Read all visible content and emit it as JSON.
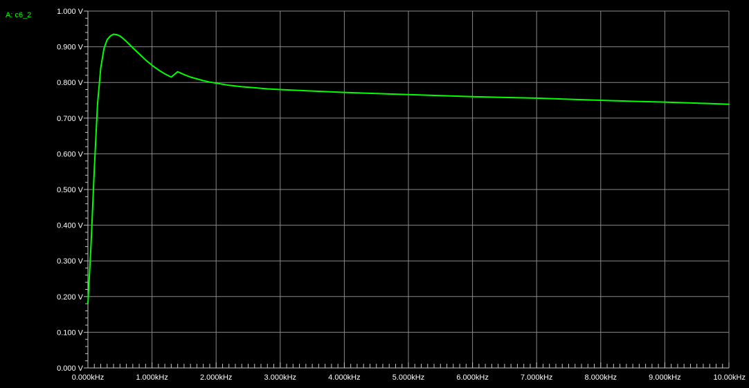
{
  "trace": {
    "label": "A: c6_2",
    "color": "#00ff00"
  },
  "chart_data": {
    "type": "line",
    "xlim": [
      0,
      10
    ],
    "ylim": [
      0,
      1
    ],
    "grid": true,
    "y_tick_labels": [
      "0.000 V",
      "0.100 V",
      "0.200 V",
      "0.300 V",
      "0.400 V",
      "0.500 V",
      "0.600 V",
      "0.700 V",
      "0.800 V",
      "0.900 V",
      "1.000 V"
    ],
    "x_tick_labels": [
      "0.000kHz",
      "1.000kHz",
      "2.000kHz",
      "3.000kHz",
      "4.000kHz",
      "5.000kHz",
      "6.000kHz",
      "7.000kHz",
      "8.000kHz",
      "9.000kHz",
      "10.00kHz"
    ],
    "series": [
      {
        "color": "#00ff00",
        "x": [
          0.0,
          0.05,
          0.1,
          0.15,
          0.2,
          0.25,
          0.3,
          0.35,
          0.4,
          0.45,
          0.5,
          0.55,
          0.6,
          0.65,
          0.7,
          0.8,
          0.9,
          1.0,
          1.1,
          1.2,
          1.3,
          1.4,
          1.5,
          1.6,
          1.7,
          1.8,
          1.9,
          2.0,
          2.2,
          2.4,
          2.6,
          2.8,
          3.0,
          3.5,
          4.0,
          4.5,
          5.0,
          5.5,
          6.0,
          6.5,
          7.0,
          7.5,
          8.0,
          8.5,
          9.0,
          9.5,
          10.0
        ],
        "y": [
          0.18,
          0.35,
          0.56,
          0.74,
          0.84,
          0.895,
          0.92,
          0.93,
          0.935,
          0.934,
          0.93,
          0.923,
          0.915,
          0.906,
          0.897,
          0.88,
          0.863,
          0.848,
          0.835,
          0.824,
          0.815,
          0.83,
          0.822,
          0.815,
          0.81,
          0.805,
          0.801,
          0.798,
          0.792,
          0.788,
          0.785,
          0.782,
          0.78,
          0.776,
          0.772,
          0.769,
          0.766,
          0.763,
          0.76,
          0.758,
          0.756,
          0.753,
          0.75,
          0.747,
          0.745,
          0.742,
          0.739
        ]
      }
    ]
  }
}
